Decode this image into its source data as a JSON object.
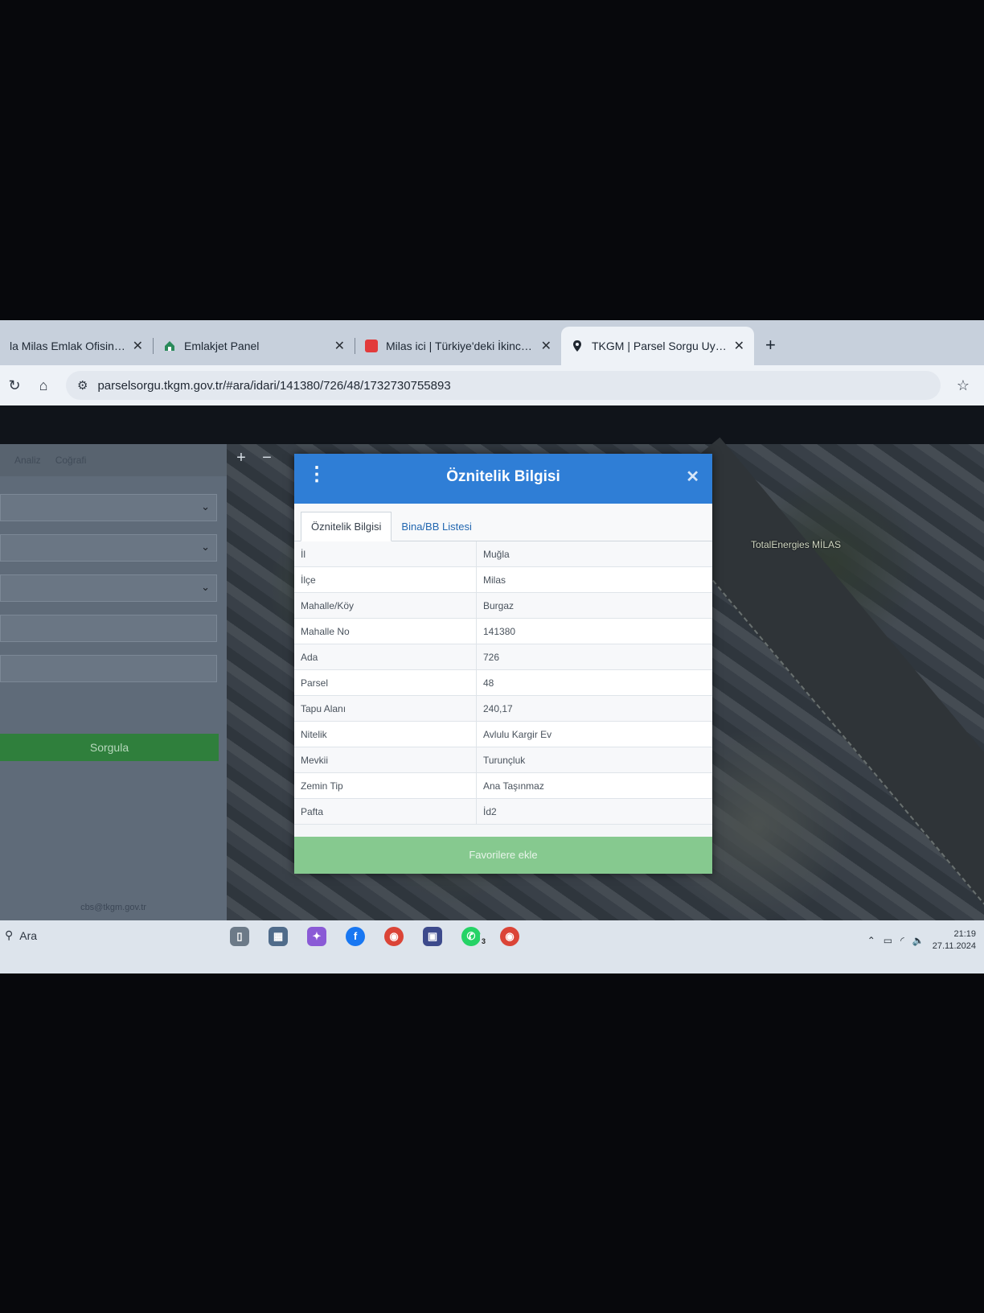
{
  "browser": {
    "tabs": [
      {
        "title": "la Milas Emlak Ofisinden Sa",
        "icon": "page-icon"
      },
      {
        "title": "Emlakjet Panel",
        "icon": "emlakjet-icon"
      },
      {
        "title": "Milas ici | Türkiye'deki İkinci El E",
        "icon": "sahibinden-icon"
      },
      {
        "title": "TKGM | Parsel Sorgu Uygulamas",
        "icon": "location-pin-icon",
        "active": true
      }
    ],
    "new_tab": "+",
    "url": "parselsorgu.tkgm.gov.tr/#ara/idari/141380/726/48/1732730755893"
  },
  "sidebar": {
    "tabs": [
      "Analiz",
      "Coğrafi"
    ],
    "submit_label": "Sorgula",
    "footer_email": "cbs@tkgm.gov.tr"
  },
  "map": {
    "poi_label": "TotalEnergies MİLAS",
    "zoom_in": "+",
    "zoom_out": "−"
  },
  "dialog": {
    "title": "Öznitelik Bilgisi",
    "tabs": [
      "Öznitelik Bilgisi",
      "Bina/BB Listesi"
    ],
    "rows": [
      {
        "key": "İl",
        "value": "Muğla"
      },
      {
        "key": "İlçe",
        "value": "Milas"
      },
      {
        "key": "Mahalle/Köy",
        "value": "Burgaz"
      },
      {
        "key": "Mahalle No",
        "value": "141380"
      },
      {
        "key": "Ada",
        "value": "726"
      },
      {
        "key": "Parsel",
        "value": "48"
      },
      {
        "key": "Tapu Alanı",
        "value": "240,17"
      },
      {
        "key": "Nitelik",
        "value": "Avlulu Kargir Ev"
      },
      {
        "key": "Mevkii",
        "value": "Turunçluk"
      },
      {
        "key": "Zemin Tip",
        "value": "Ana Taşınmaz"
      },
      {
        "key": "Pafta",
        "value": "İd2"
      }
    ],
    "favorite_label": "Favorilere ekle"
  },
  "taskbar": {
    "search_placeholder": "Ara",
    "time": "21:19",
    "date": "27.11.2024",
    "whatsapp_badge": "3"
  }
}
